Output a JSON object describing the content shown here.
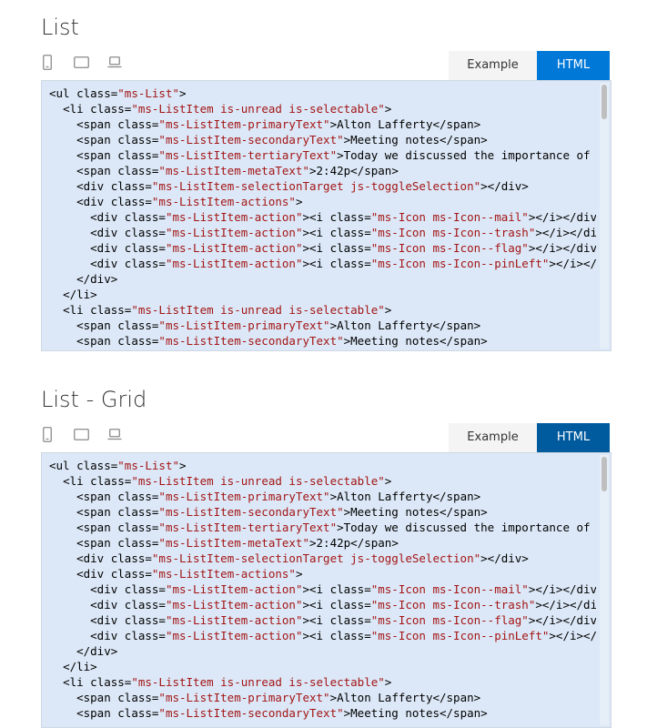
{
  "sections": [
    {
      "title": "List",
      "tabs": {
        "example": "Example",
        "html": "HTML"
      },
      "devices": [
        "phone-icon",
        "tablet-icon",
        "laptop-icon"
      ],
      "code_lines": [
        [
          [
            "tag",
            "<ul "
          ],
          [
            "attr",
            "class="
          ],
          [
            "val",
            "\"ms-List\""
          ],
          [
            "tag",
            ">"
          ]
        ],
        [
          [
            "txt",
            "  "
          ],
          [
            "tag",
            "<li "
          ],
          [
            "attr",
            "class="
          ],
          [
            "val",
            "\"ms-ListItem is-unread is-selectable\""
          ],
          [
            "tag",
            ">"
          ]
        ],
        [
          [
            "txt",
            "    "
          ],
          [
            "tag",
            "<span "
          ],
          [
            "attr",
            "class="
          ],
          [
            "val",
            "\"ms-ListItem-primaryText\""
          ],
          [
            "tag",
            ">"
          ],
          [
            "txt",
            "Alton Lafferty"
          ],
          [
            "tag",
            "</span>"
          ]
        ],
        [
          [
            "txt",
            "    "
          ],
          [
            "tag",
            "<span "
          ],
          [
            "attr",
            "class="
          ],
          [
            "val",
            "\"ms-ListItem-secondaryText\""
          ],
          [
            "tag",
            ">"
          ],
          [
            "txt",
            "Meeting notes"
          ],
          [
            "tag",
            "</span>"
          ]
        ],
        [
          [
            "txt",
            "    "
          ],
          [
            "tag",
            "<span "
          ],
          [
            "attr",
            "class="
          ],
          [
            "val",
            "\"ms-ListItem-tertiaryText\""
          ],
          [
            "tag",
            ">"
          ],
          [
            "txt",
            "Today we discussed the importance of"
          ]
        ],
        [
          [
            "txt",
            "    "
          ],
          [
            "tag",
            "<span "
          ],
          [
            "attr",
            "class="
          ],
          [
            "val",
            "\"ms-ListItem-metaText\""
          ],
          [
            "tag",
            ">"
          ],
          [
            "txt",
            "2:42p"
          ],
          [
            "tag",
            "</span>"
          ]
        ],
        [
          [
            "txt",
            "    "
          ],
          [
            "tag",
            "<div "
          ],
          [
            "attr",
            "class="
          ],
          [
            "val",
            "\"ms-ListItem-selectionTarget js-toggleSelection\""
          ],
          [
            "tag",
            "></div>"
          ]
        ],
        [
          [
            "txt",
            "    "
          ],
          [
            "tag",
            "<div "
          ],
          [
            "attr",
            "class="
          ],
          [
            "val",
            "\"ms-ListItem-actions\""
          ],
          [
            "tag",
            ">"
          ]
        ],
        [
          [
            "txt",
            "      "
          ],
          [
            "tag",
            "<div "
          ],
          [
            "attr",
            "class="
          ],
          [
            "val",
            "\"ms-ListItem-action\""
          ],
          [
            "tag",
            "><i "
          ],
          [
            "attr",
            "class="
          ],
          [
            "val",
            "\"ms-Icon ms-Icon--mail\""
          ],
          [
            "tag",
            "></i></div>"
          ]
        ],
        [
          [
            "txt",
            "      "
          ],
          [
            "tag",
            "<div "
          ],
          [
            "attr",
            "class="
          ],
          [
            "val",
            "\"ms-ListItem-action\""
          ],
          [
            "tag",
            "><i "
          ],
          [
            "attr",
            "class="
          ],
          [
            "val",
            "\"ms-Icon ms-Icon--trash\""
          ],
          [
            "tag",
            "></i></div>"
          ]
        ],
        [
          [
            "txt",
            "      "
          ],
          [
            "tag",
            "<div "
          ],
          [
            "attr",
            "class="
          ],
          [
            "val",
            "\"ms-ListItem-action\""
          ],
          [
            "tag",
            "><i "
          ],
          [
            "attr",
            "class="
          ],
          [
            "val",
            "\"ms-Icon ms-Icon--flag\""
          ],
          [
            "tag",
            "></i></div>"
          ]
        ],
        [
          [
            "txt",
            "      "
          ],
          [
            "tag",
            "<div "
          ],
          [
            "attr",
            "class="
          ],
          [
            "val",
            "\"ms-ListItem-action\""
          ],
          [
            "tag",
            "><i "
          ],
          [
            "attr",
            "class="
          ],
          [
            "val",
            "\"ms-Icon ms-Icon--pinLeft\""
          ],
          [
            "tag",
            "></i></div>"
          ]
        ],
        [
          [
            "txt",
            "    "
          ],
          [
            "tag",
            "</div>"
          ]
        ],
        [
          [
            "txt",
            "  "
          ],
          [
            "tag",
            "</li>"
          ]
        ],
        [
          [
            "txt",
            "  "
          ],
          [
            "tag",
            "<li "
          ],
          [
            "attr",
            "class="
          ],
          [
            "val",
            "\"ms-ListItem is-unread is-selectable\""
          ],
          [
            "tag",
            ">"
          ]
        ],
        [
          [
            "txt",
            "    "
          ],
          [
            "tag",
            "<span "
          ],
          [
            "attr",
            "class="
          ],
          [
            "val",
            "\"ms-ListItem-primaryText\""
          ],
          [
            "tag",
            ">"
          ],
          [
            "txt",
            "Alton Lafferty"
          ],
          [
            "tag",
            "</span>"
          ]
        ],
        [
          [
            "txt",
            "    "
          ],
          [
            "tag",
            "<span "
          ],
          [
            "attr",
            "class="
          ],
          [
            "val",
            "\"ms-ListItem-secondaryText\""
          ],
          [
            "tag",
            ">"
          ],
          [
            "txt",
            "Meeting notes"
          ],
          [
            "tag",
            "</span>"
          ]
        ]
      ]
    },
    {
      "title": "List - Grid",
      "tabs": {
        "example": "Example",
        "html": "HTML"
      },
      "devices": [
        "phone-icon",
        "tablet-icon",
        "laptop-icon"
      ],
      "code_lines": [
        [
          [
            "tag",
            "<ul "
          ],
          [
            "attr",
            "class="
          ],
          [
            "val",
            "\"ms-List\""
          ],
          [
            "tag",
            ">"
          ]
        ],
        [
          [
            "txt",
            "  "
          ],
          [
            "tag",
            "<li "
          ],
          [
            "attr",
            "class="
          ],
          [
            "val",
            "\"ms-ListItem is-unread is-selectable\""
          ],
          [
            "tag",
            ">"
          ]
        ],
        [
          [
            "txt",
            "    "
          ],
          [
            "tag",
            "<span "
          ],
          [
            "attr",
            "class="
          ],
          [
            "val",
            "\"ms-ListItem-primaryText\""
          ],
          [
            "tag",
            ">"
          ],
          [
            "txt",
            "Alton Lafferty"
          ],
          [
            "tag",
            "</span>"
          ]
        ],
        [
          [
            "txt",
            "    "
          ],
          [
            "tag",
            "<span "
          ],
          [
            "attr",
            "class="
          ],
          [
            "val",
            "\"ms-ListItem-secondaryText\""
          ],
          [
            "tag",
            ">"
          ],
          [
            "txt",
            "Meeting notes"
          ],
          [
            "tag",
            "</span>"
          ]
        ],
        [
          [
            "txt",
            "    "
          ],
          [
            "tag",
            "<span "
          ],
          [
            "attr",
            "class="
          ],
          [
            "val",
            "\"ms-ListItem-tertiaryText\""
          ],
          [
            "tag",
            ">"
          ],
          [
            "txt",
            "Today we discussed the importance of"
          ]
        ],
        [
          [
            "txt",
            "    "
          ],
          [
            "tag",
            "<span "
          ],
          [
            "attr",
            "class="
          ],
          [
            "val",
            "\"ms-ListItem-metaText\""
          ],
          [
            "tag",
            ">"
          ],
          [
            "txt",
            "2:42p"
          ],
          [
            "tag",
            "</span>"
          ]
        ],
        [
          [
            "txt",
            "    "
          ],
          [
            "tag",
            "<div "
          ],
          [
            "attr",
            "class="
          ],
          [
            "val",
            "\"ms-ListItem-selectionTarget js-toggleSelection\""
          ],
          [
            "tag",
            "></div>"
          ]
        ],
        [
          [
            "txt",
            "    "
          ],
          [
            "tag",
            "<div "
          ],
          [
            "attr",
            "class="
          ],
          [
            "val",
            "\"ms-ListItem-actions\""
          ],
          [
            "tag",
            ">"
          ]
        ],
        [
          [
            "txt",
            "      "
          ],
          [
            "tag",
            "<div "
          ],
          [
            "attr",
            "class="
          ],
          [
            "val",
            "\"ms-ListItem-action\""
          ],
          [
            "tag",
            "><i "
          ],
          [
            "attr",
            "class="
          ],
          [
            "val",
            "\"ms-Icon ms-Icon--mail\""
          ],
          [
            "tag",
            "></i></div>"
          ]
        ],
        [
          [
            "txt",
            "      "
          ],
          [
            "tag",
            "<div "
          ],
          [
            "attr",
            "class="
          ],
          [
            "val",
            "\"ms-ListItem-action\""
          ],
          [
            "tag",
            "><i "
          ],
          [
            "attr",
            "class="
          ],
          [
            "val",
            "\"ms-Icon ms-Icon--trash\""
          ],
          [
            "tag",
            "></i></div>"
          ]
        ],
        [
          [
            "txt",
            "      "
          ],
          [
            "tag",
            "<div "
          ],
          [
            "attr",
            "class="
          ],
          [
            "val",
            "\"ms-ListItem-action\""
          ],
          [
            "tag",
            "><i "
          ],
          [
            "attr",
            "class="
          ],
          [
            "val",
            "\"ms-Icon ms-Icon--flag\""
          ],
          [
            "tag",
            "></i></div>"
          ]
        ],
        [
          [
            "txt",
            "      "
          ],
          [
            "tag",
            "<div "
          ],
          [
            "attr",
            "class="
          ],
          [
            "val",
            "\"ms-ListItem-action\""
          ],
          [
            "tag",
            "><i "
          ],
          [
            "attr",
            "class="
          ],
          [
            "val",
            "\"ms-Icon ms-Icon--pinLeft\""
          ],
          [
            "tag",
            "></i></div>"
          ]
        ],
        [
          [
            "txt",
            "    "
          ],
          [
            "tag",
            "</div>"
          ]
        ],
        [
          [
            "txt",
            "  "
          ],
          [
            "tag",
            "</li>"
          ]
        ],
        [
          [
            "txt",
            "  "
          ],
          [
            "tag",
            "<li "
          ],
          [
            "attr",
            "class="
          ],
          [
            "val",
            "\"ms-ListItem is-unread is-selectable\""
          ],
          [
            "tag",
            ">"
          ]
        ],
        [
          [
            "txt",
            "    "
          ],
          [
            "tag",
            "<span "
          ],
          [
            "attr",
            "class="
          ],
          [
            "val",
            "\"ms-ListItem-primaryText\""
          ],
          [
            "tag",
            ">"
          ],
          [
            "txt",
            "Alton Lafferty"
          ],
          [
            "tag",
            "</span>"
          ]
        ],
        [
          [
            "txt",
            "    "
          ],
          [
            "tag",
            "<span "
          ],
          [
            "attr",
            "class="
          ],
          [
            "val",
            "\"ms-ListItem-secondaryText\""
          ],
          [
            "tag",
            ">"
          ],
          [
            "txt",
            "Meeting notes"
          ],
          [
            "tag",
            "</span>"
          ]
        ]
      ]
    }
  ]
}
